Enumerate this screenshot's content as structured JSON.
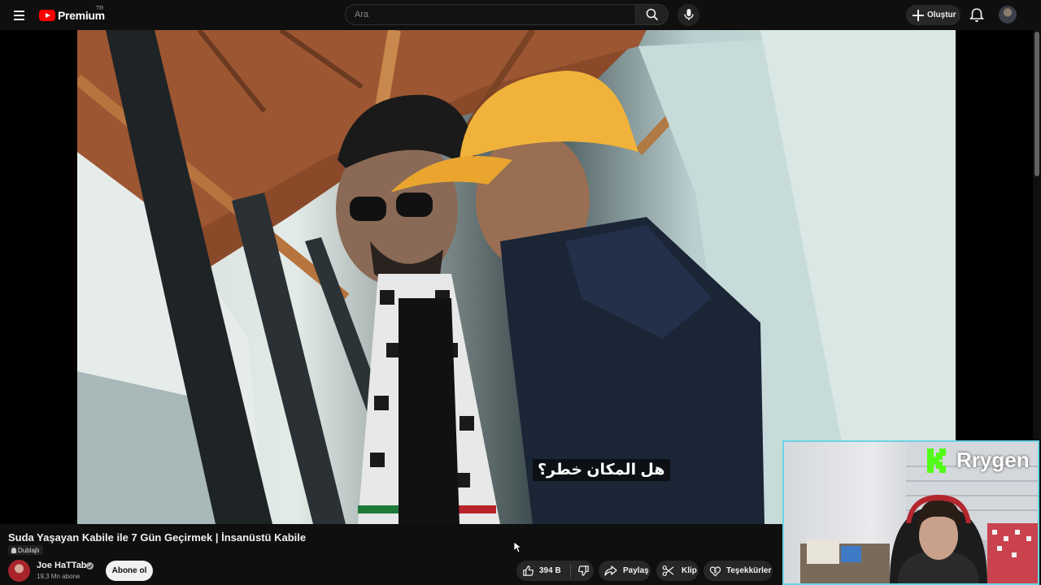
{
  "header": {
    "logo_text": "Premium",
    "country_code": "TR",
    "search_placeholder": "Ara",
    "create_label": "Oluştur",
    "icons": [
      "menu-icon",
      "youtube-logo-icon",
      "search-icon",
      "mic-icon",
      "plus-icon",
      "bell-icon"
    ]
  },
  "video": {
    "subtitle": "هل المكان خطر؟",
    "title": "Suda Yaşayan Kabile ile 7 Gün Geçirmek | İnsanüstü Kabile",
    "badge": "Dublajlı"
  },
  "channel": {
    "name": "Joe HaTTab",
    "subscribers": "19,3 Mn abone",
    "subscribe_label": "Abone ol"
  },
  "actions": {
    "like_count": "394 B",
    "share_label": "Paylaş",
    "clip_label": "Klip",
    "thanks_label": "Teşekkürler"
  },
  "overlay": {
    "streamer_name": "Rrygen"
  },
  "colors": {
    "background": "#0f0f0f",
    "logo_red": "#ff0000",
    "pill": "#272727",
    "subscribe_bg": "#f1f1f1",
    "cam_border": "#6ad4e4",
    "overlay_logo": "#53fc18"
  }
}
